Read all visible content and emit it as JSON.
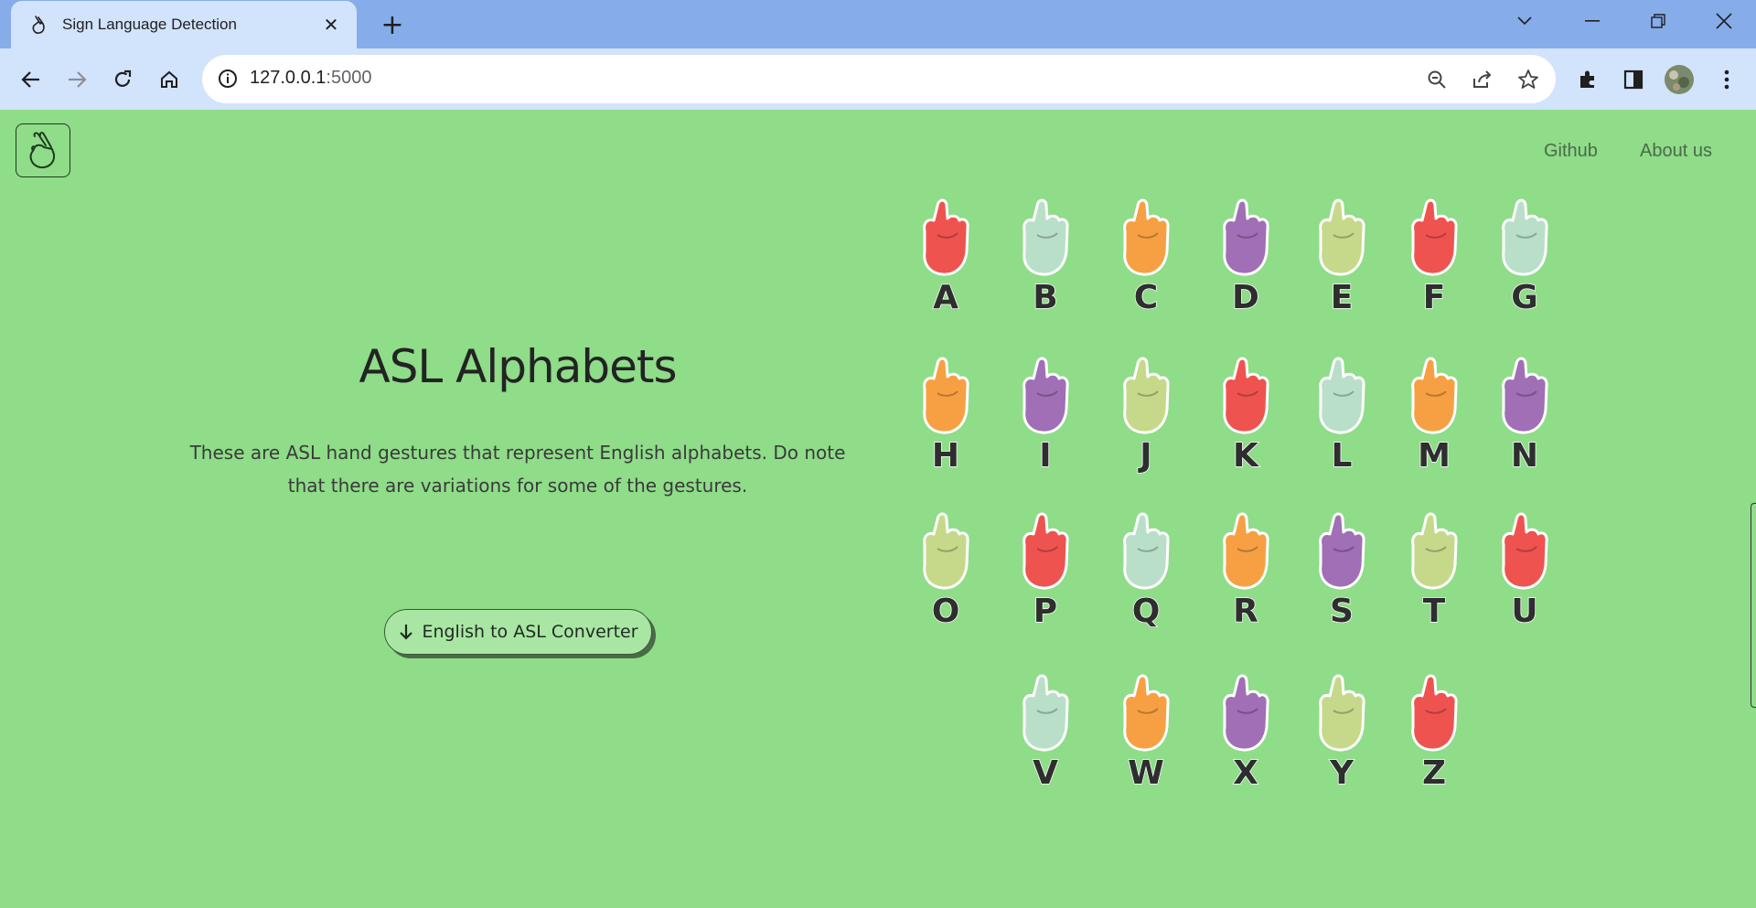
{
  "browser": {
    "tab_title": "Sign Language Detection",
    "url_host": "127.0.0.1",
    "url_port": ":5000"
  },
  "nav": {
    "links": [
      "Github",
      "About us"
    ]
  },
  "hero": {
    "title": "ASL Alphabets",
    "description": "These are ASL hand gestures that represent English alphabets. Do note that there are variations for some of the gestures.",
    "button_label": "English to ASL Converter"
  },
  "alphabet": {
    "letters": [
      "A",
      "B",
      "C",
      "D",
      "E",
      "F",
      "G",
      "H",
      "I",
      "J",
      "K",
      "L",
      "M",
      "N",
      "O",
      "P",
      "Q",
      "R",
      "S",
      "T",
      "U",
      "V",
      "W",
      "X",
      "Y",
      "Z"
    ],
    "hand_colors": [
      "#ef5350",
      "#b9dfc8",
      "#f7a043",
      "#a06fb6",
      "#c6d98a",
      "#ef5350",
      "#b9dfc8",
      "#f7a043",
      "#a06fb6",
      "#c6d98a",
      "#ef5350",
      "#b9dfc8",
      "#f7a043",
      "#a06fb6",
      "#c6d98a",
      "#ef5350",
      "#b9dfc8",
      "#f7a043",
      "#a06fb6",
      "#c6d98a",
      "#ef5350",
      "#b9dfc8",
      "#f7a043",
      "#a06fb6",
      "#c6d98a",
      "#ef5350"
    ]
  },
  "colors": {
    "page_background": "#8fdc89",
    "tab_strip": "#86acea",
    "toolbar": "#d2e3fc"
  }
}
